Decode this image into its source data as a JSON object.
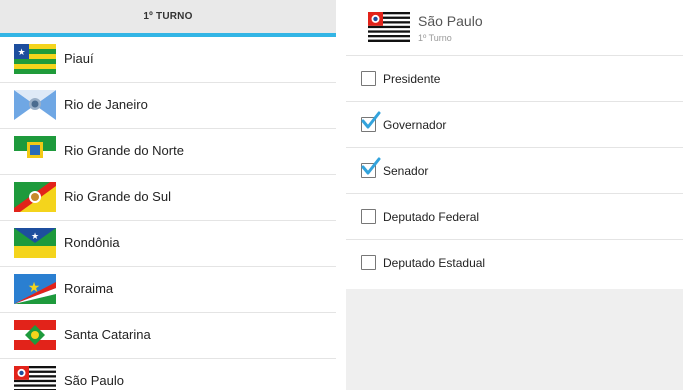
{
  "tab": {
    "label": "1º TURNO"
  },
  "states": [
    {
      "name": "Piauí",
      "flag": "piaui-flag"
    },
    {
      "name": "Rio de Janeiro",
      "flag": "rio-de-janeiro-flag"
    },
    {
      "name": "Rio Grande do Norte",
      "flag": "rio-grande-do-norte-flag"
    },
    {
      "name": "Rio Grande do Sul",
      "flag": "rio-grande-do-sul-flag"
    },
    {
      "name": "Rondônia",
      "flag": "rondonia-flag"
    },
    {
      "name": "Roraima",
      "flag": "roraima-flag"
    },
    {
      "name": "Santa Catarina",
      "flag": "santa-catarina-flag"
    },
    {
      "name": "São Paulo",
      "flag": "sao-paulo-flag"
    }
  ],
  "detail": {
    "state": "São Paulo",
    "round": "1º Turno",
    "flag": "sao-paulo-flag",
    "options": [
      {
        "label": "Presidente",
        "checked": false
      },
      {
        "label": "Governador",
        "checked": true
      },
      {
        "label": "Senador",
        "checked": true
      },
      {
        "label": "Deputado Federal",
        "checked": false
      },
      {
        "label": "Deputado Estadual",
        "checked": false
      }
    ]
  },
  "colors": {
    "accent": "#33b5e5",
    "tab_bg": "#e9e9e9",
    "panel_bg": "#efefef"
  }
}
